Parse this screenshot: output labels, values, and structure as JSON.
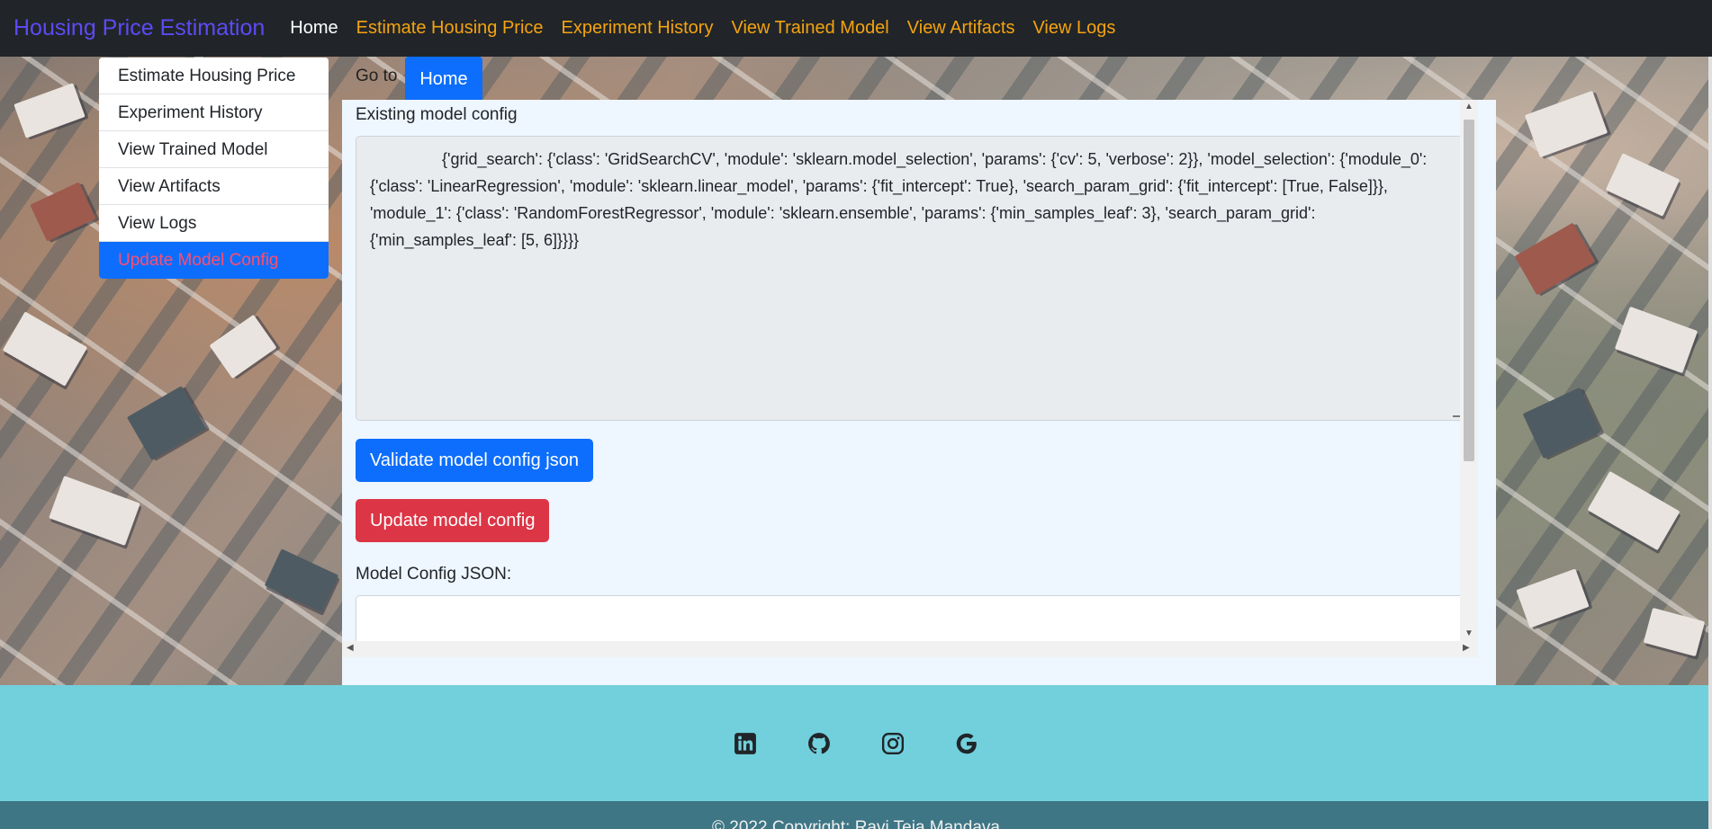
{
  "navbar": {
    "brand": "Housing Price Estimation",
    "links": [
      {
        "label": "Home",
        "active": true
      },
      {
        "label": "Estimate Housing Price",
        "active": false
      },
      {
        "label": "Experiment History",
        "active": false
      },
      {
        "label": "View Trained Model",
        "active": false
      },
      {
        "label": "View Artifacts",
        "active": false
      },
      {
        "label": "View Logs",
        "active": false
      }
    ]
  },
  "side_menu": {
    "items": [
      {
        "label": "Estimate Housing Price"
      },
      {
        "label": "Experiment History"
      },
      {
        "label": "View Trained Model"
      },
      {
        "label": "View Artifacts"
      },
      {
        "label": "View Logs"
      },
      {
        "label": "Update Model Config",
        "active": true
      }
    ]
  },
  "goto": {
    "label": "Go to",
    "button": "Home"
  },
  "main": {
    "existing_label": "Existing model config",
    "existing_config": "                {'grid_search': {'class': 'GridSearchCV', 'module': 'sklearn.model_selection', 'params': {'cv': 5, 'verbose': 2}}, 'model_selection': {'module_0': {'class': 'LinearRegression', 'module': 'sklearn.linear_model', 'params': {'fit_intercept': True}, 'search_param_grid': {'fit_intercept': [True, False]}}, 'module_1': {'class': 'RandomForestRegressor', 'module': 'sklearn.ensemble', 'params': {'min_samples_leaf': 3}, 'search_param_grid': {'min_samples_leaf': [5, 6]}}}}",
    "validate_button": "Validate model config json",
    "update_button": "Update model config",
    "json_label": "Model Config JSON:",
    "json_value": ""
  },
  "footer": {
    "icons": [
      "linkedin-icon",
      "github-icon",
      "instagram-icon",
      "google-icon"
    ],
    "copyright": "© 2022 Copyright: Ravi Teja Mandava"
  },
  "colors": {
    "navbar_bg": "#212529",
    "nav_link": "#f5a30f",
    "primary": "#0d6efd",
    "danger": "#dc3545",
    "footer_top": "#71d0dc",
    "footer_bottom": "#3e7685"
  }
}
